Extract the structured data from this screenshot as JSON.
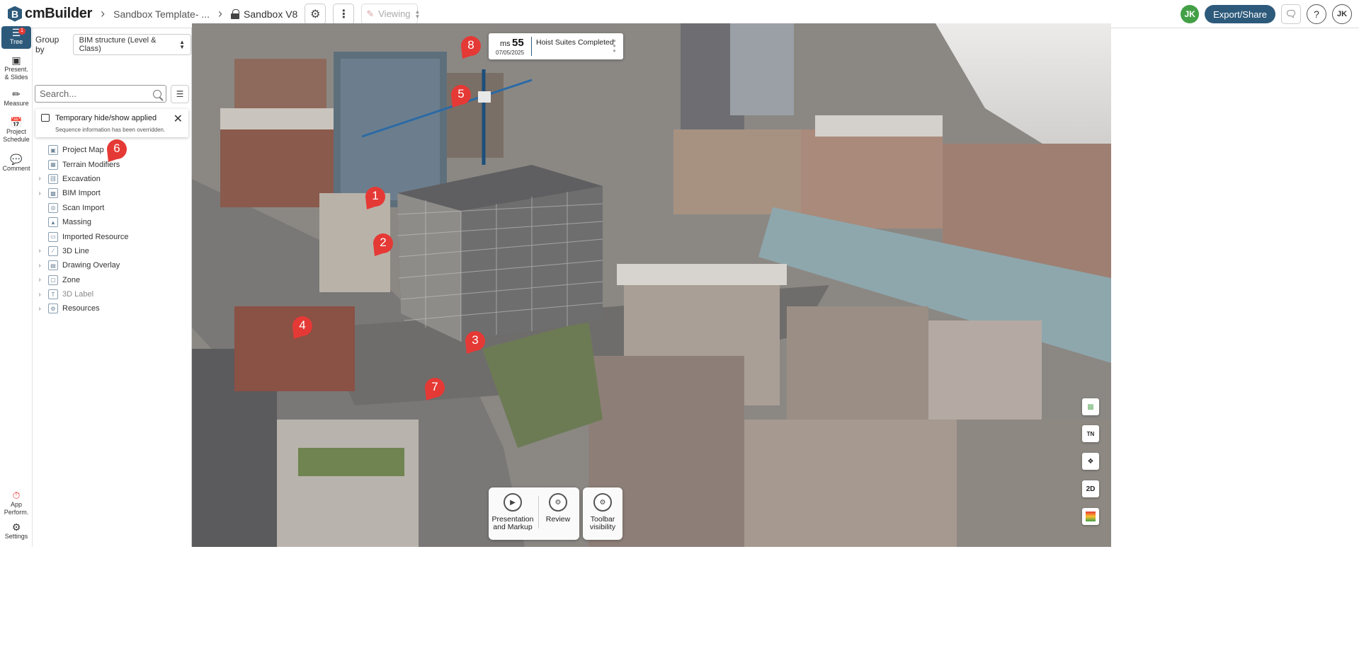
{
  "topbar": {
    "logo_letter": "B",
    "app_name": "cmBuilder",
    "crumb_1": "Sandbox Template- ...",
    "crumb_2": "Sandbox V8",
    "viewing_label": "Viewing",
    "user_initials": "JK",
    "export_label": "Export/Share",
    "profile_initials": "JK"
  },
  "rail": {
    "tree_label": "Tree",
    "tree_badge": "1",
    "present_label": "Present. & Slides",
    "measure_label": "Measure",
    "schedule_label": "Project Schedule",
    "comment_label": "Comment",
    "perf_label": "App Perform.",
    "settings_label": "Settings"
  },
  "panel": {
    "groupby_label": "Group by",
    "groupby_value": "BIM structure (Level & Class)",
    "search_placeholder": "Search...",
    "notice_title": "Temporary hide/show applied",
    "notice_sub": "Sequence information has been overridden.",
    "tree_items": [
      {
        "label": "Project Map",
        "expandable": false,
        "icon": "map-icon"
      },
      {
        "label": "Terrain Modifiers",
        "expandable": false,
        "icon": "terrain-icon"
      },
      {
        "label": "Excavation",
        "expandable": true,
        "icon": "shovel-icon"
      },
      {
        "label": "BIM Import",
        "expandable": true,
        "icon": "bim-icon"
      },
      {
        "label": "Scan Import",
        "expandable": false,
        "icon": "scan-icon"
      },
      {
        "label": "Massing",
        "expandable": false,
        "icon": "massing-icon"
      },
      {
        "label": "Imported Resource",
        "expandable": false,
        "icon": "cube-icon"
      },
      {
        "label": "3D Line",
        "expandable": true,
        "icon": "line-icon"
      },
      {
        "label": "Drawing Overlay",
        "expandable": true,
        "icon": "image-icon"
      },
      {
        "label": "Zone",
        "expandable": true,
        "icon": "zone-icon"
      },
      {
        "label": "3D Label",
        "expandable": true,
        "icon": "text-icon"
      },
      {
        "label": "Resources",
        "expandable": true,
        "icon": "resources-icon"
      }
    ]
  },
  "milestone": {
    "prefix": "ms",
    "number": "55",
    "date": "07/05/2025",
    "title": "Hoist Suites Completed"
  },
  "toolbar": {
    "presentation_label": "Presentation and Markup",
    "review_label": "Review",
    "visibility_label": "Toolbar visibility"
  },
  "right_tools": {
    "north_label": "TN",
    "mode_label": "2D"
  },
  "markers": [
    "1",
    "2",
    "3",
    "4",
    "5",
    "6",
    "7",
    "8"
  ],
  "colors": {
    "brand": "#2d5a7b",
    "marker": "#e53935",
    "avatar": "#43a047"
  }
}
